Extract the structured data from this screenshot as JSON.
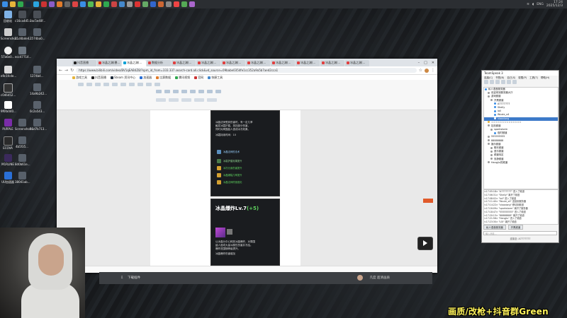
{
  "taskbar": {
    "tray_lang": "ENG",
    "clock_time": "17:24",
    "clock_date": "2025/12/3"
  },
  "desktop_icons": [
    {
      "label": "回收站"
    },
    {
      "label": "c16ca4d5..."
    },
    {
      "label": "0ac5e40f..."
    },
    {
      "label": "Screenshot..."
    },
    {
      "label": "11d4bde4..."
    },
    {
      "label": "2574ba0..."
    },
    {
      "label": "57a6e0..."
    },
    {
      "label": "ecc47714..."
    },
    {
      "label": "e9c1fcde..."
    },
    {
      "label": "1274b4..."
    },
    {
      "label": "c046452..."
    },
    {
      "label": "14a9b242..."
    },
    {
      "label": "9f6fa040..."
    },
    {
      "label": "0c2a543..."
    },
    {
      "label": "PURPLE"
    },
    {
      "label": "Screenshot..."
    },
    {
      "label": "36d7b713..."
    },
    {
      "label": "ECOVA"
    },
    {
      "label": "4b5f35..."
    },
    {
      "label": "M1RLINE"
    },
    {
      "label": "8d0b61e..."
    },
    {
      "label": "UU加速器"
    },
    {
      "label": "38041ab..."
    }
  ],
  "browser": {
    "tabs": [
      {
        "label": "抖音直播"
      },
      {
        "label": "冰晶之渊(暴..."
      },
      {
        "label": "冰晶之渊(..."
      },
      {
        "label": "数据分析"
      },
      {
        "label": "冰晶之渊(..."
      },
      {
        "label": "冰晶之渊(..."
      },
      {
        "label": "冰晶之渊(..."
      },
      {
        "label": "冰晶之渊(..."
      },
      {
        "label": "冰晶之渊(..."
      },
      {
        "label": "冰晶之渊(..."
      },
      {
        "label": "冰晶之渊(..."
      },
      {
        "label": "冰晶之渊(..."
      }
    ],
    "url": "https://www.bilibili.com/video/BV1qEAB4Z8/?spm_id_from=333.337.search-card.all.click&vd_source=09babe0354fe1cc352a9a5b7aed2cca1",
    "bookmarks": [
      {
        "label": "游戏工具"
      },
      {
        "label": "抖音直播"
      },
      {
        "label": "Steam 资讯中心"
      },
      {
        "label": "加速器"
      },
      {
        "label": "比赛数据"
      },
      {
        "label": "腾讯视频"
      },
      {
        "label": "官网"
      },
      {
        "label": "快捷工具"
      }
    ]
  },
  "doc": {
    "card1_lines": [
      "冰晶法师受到伤害时，有一定几率",
      "触发冰霜护盾，抵挡部分伤害，",
      "同时对周围敌人造成冰冻效果。"
    ],
    "card1_extra": "冰霜持续时间：10",
    "card1_rows": [
      "冰晶法师的法术",
      "冰霜护盾效果提升",
      "冰冻元素伤害提升",
      "冰晶爆裂几率提升",
      "冰晶法师终极强化"
    ],
    "card2_title": "冰晶爆炸Lv.7",
    "card2_bonus": "(+5)",
    "card2_lines": [
      "以冰晶为中心释放冰晶爆炸，对周围",
      "敌人造成大量冰属性伤害并冻结。",
      "爆炸范围随等级提升。"
    ],
    "card2_extra": "冰晶爆炸伤害增加"
  },
  "stream_bar": {
    "label": "下载插件",
    "user": "凡度 超清画质"
  },
  "teamspeak": {
    "title": "TeamSpeak 3",
    "menu": [
      "连接(C)",
      "书签(B)",
      "自己(S)",
      "权限(P)",
      "工具(T)",
      "帮助(H)"
    ],
    "tree": [
      {
        "label": "私人语音服务器",
        "sel": false
      },
      {
        "label": "欢迎来到服务器大厅",
        "sel": false
      },
      {
        "label": "游戏频道",
        "sel": false
      },
      {
        "label": "开黑频道",
        "sel": false
      },
      {
        "label": "A7777777",
        "sel": false
      },
      {
        "label": "Shelly",
        "sel": false
      },
      {
        "label": "loli",
        "sel": false
      },
      {
        "label": "Wuxie_x4",
        "sel": false
      },
      {
        "label": "xiaoxiong",
        "sel": true
      },
      {
        "label": "☆☆☆☆☆☆☆☆☆☆☆☆☆☆",
        "sel": false
      },
      {
        "label": "挂机频道",
        "sel": false
      },
      {
        "label": "sparkstorm",
        "sel": false
      },
      {
        "label": "临时频道",
        "sel": false
      },
      {
        "label": "555555555",
        "sel": false
      },
      {
        "label": "88888888",
        "sel": false
      },
      {
        "label": "娱乐频道",
        "sel": false
      },
      {
        "label": "聊天频道",
        "sel": false
      },
      {
        "label": "音乐频道",
        "sel": false
      },
      {
        "label": "频道待定",
        "sel": false
      },
      {
        "label": "安静频道",
        "sel": false
      },
      {
        "label": "Hangjiu的频道",
        "sel": false
      }
    ],
    "chat": [
      "<17:05:18> \"A7777777\" 进入了频道",
      "<17:06:31> \"Shelly\" 离开了频道",
      "<17:08:02> \"loli\" 进入了频道",
      "<17:11:40> \"Wuxie_x4\" 连接到服务器",
      "<17:14:22> \"xiaoxiong\" 移动到频道",
      "<17:16:09> \"sparkstorm\" 离开了服务器",
      "<17:18:47> \"555555555\" 进入了频道",
      "<17:20:13> \"88888888\" 离开了频道",
      "<17:21:56> \"Hangjiu\" 进入了频道",
      "<17:23:30> \"LOI\" 离开了频道"
    ],
    "tabs": [
      "私人语音服务器",
      "开黑频道"
    ],
    "input_placeholder": "输入消息...",
    "status": "连接至: A7777777"
  },
  "caption": "画质/改枪+抖音群Green"
}
